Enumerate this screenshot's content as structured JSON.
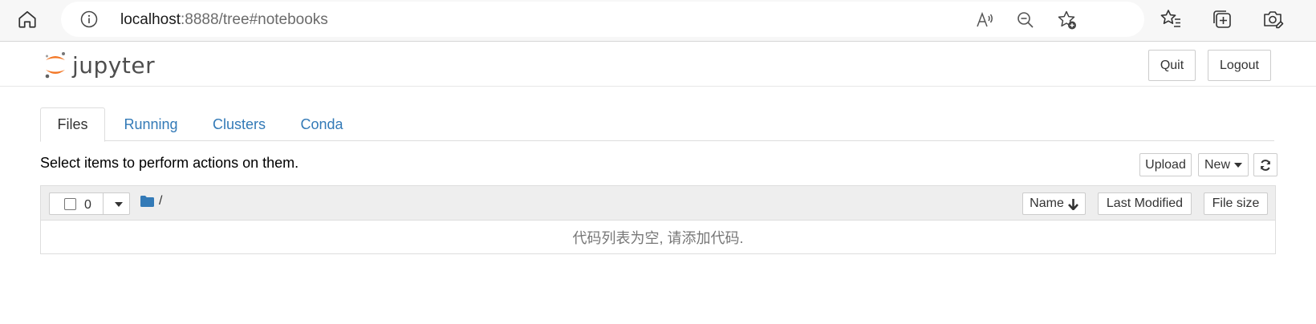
{
  "browser": {
    "url_host": "localhost",
    "url_path": ":8888/tree#notebooks",
    "icons": [
      "home-icon",
      "info-icon",
      "read-aloud-icon",
      "zoom-out-icon",
      "add-favorite-icon",
      "favorites-icon",
      "collections-icon",
      "browser-essentials-icon"
    ]
  },
  "header": {
    "logo_text": "jupyter",
    "quit_label": "Quit",
    "logout_label": "Logout"
  },
  "tabs": [
    {
      "label": "Files",
      "active": true
    },
    {
      "label": "Running",
      "active": false
    },
    {
      "label": "Clusters",
      "active": false
    },
    {
      "label": "Conda",
      "active": false
    }
  ],
  "toolbar": {
    "instructions": "Select items to perform actions on them.",
    "upload_label": "Upload",
    "new_label": "New",
    "refresh_icon": "refresh-icon"
  },
  "list": {
    "selected_count": "0",
    "breadcrumb": "/",
    "sort_name_label": "Name",
    "sort_modified_label": "Last Modified",
    "sort_size_label": "File size",
    "empty_message": "代码列表为空, 请添加代码."
  },
  "colors": {
    "link": "#337ab7",
    "jupyter_orange": "#f37726",
    "folder": "#337ab7"
  }
}
